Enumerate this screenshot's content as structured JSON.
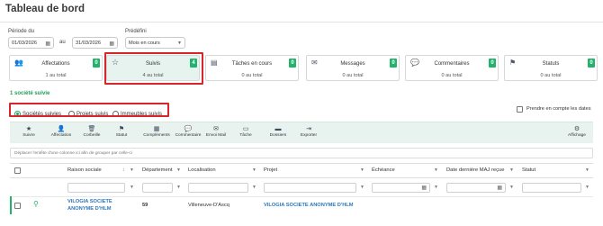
{
  "page": {
    "title": "Tableau de bord"
  },
  "period": {
    "label": "Période du",
    "from": "01/03/2026",
    "au_label": "au",
    "to": "31/03/2026",
    "predef_label": "Prédéfini",
    "predef_value": "Mois en cours"
  },
  "cards": [
    {
      "name": "Affectations",
      "count": "0",
      "sub": "1 au total"
    },
    {
      "name": "Suivis",
      "count": "4",
      "sub": "4 au total"
    },
    {
      "name": "Tâches en cours",
      "count": "0",
      "sub": "0 au total"
    },
    {
      "name": "Messages",
      "count": "0",
      "sub": "0 au total"
    },
    {
      "name": "Commentaires",
      "count": "0",
      "sub": "0 au total"
    },
    {
      "name": "Statuts",
      "count": "0",
      "sub": "0 au total"
    }
  ],
  "section": {
    "count_label": "1 société suivie"
  },
  "radios": [
    {
      "label": "Sociétés suivies",
      "selected": true
    },
    {
      "label": "Projets suivis",
      "selected": false
    },
    {
      "label": "Immeubles suivis",
      "selected": false
    }
  ],
  "dates_checkbox_label": "Prendre en compte les dates",
  "toolbar": [
    {
      "label": "Suivre",
      "icon": "star-icon"
    },
    {
      "label": "Affectation",
      "icon": "user-icon"
    },
    {
      "label": "Corbeille",
      "icon": "trash-icon"
    },
    {
      "label": "Statut",
      "icon": "flag-icon"
    },
    {
      "label": "Compléments",
      "icon": "complement-icon"
    },
    {
      "label": "Commentaire",
      "icon": "comment-icon"
    },
    {
      "label": "Envoi Mail",
      "icon": "mail-icon"
    },
    {
      "label": "Tâche",
      "icon": "task-icon"
    },
    {
      "label": "Dossiers",
      "icon": "folder-icon"
    },
    {
      "label": "Exporter",
      "icon": "export-icon"
    },
    {
      "label": "Affichage",
      "icon": "gear-icon"
    }
  ],
  "group_hint": "Déplacer l'entête d'une colonne ici afin de grouper par celle-ci",
  "columns": [
    "Raison sociale",
    "Département",
    "Localisation",
    "Projet",
    "Échéance",
    "Date dernière MAJ reçue",
    "Statut"
  ],
  "rows": [
    {
      "raison_line1": "VILOGIA SOCIETE",
      "raison_line2": "ANONYME D'HLM",
      "departement": "59",
      "localisation": "Villeneuve-D'Ascq",
      "projet": "VILOGIA SOCIETE ANONYME D'HLM"
    }
  ],
  "colors": {
    "accent": "#21b26c",
    "highlight": "#d7262b",
    "link": "#2a79c2"
  }
}
